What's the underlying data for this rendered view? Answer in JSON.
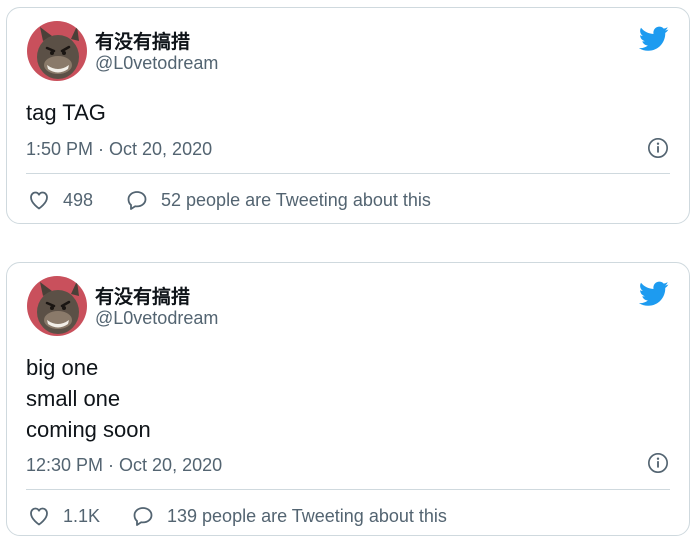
{
  "colors": {
    "twitter_blue": "#1d9bf0",
    "secondary_text": "#536471",
    "border": "#cfd9de",
    "avatar_bg": "#c9505c"
  },
  "tweets": [
    {
      "display_name": "有没有搞措",
      "handle": "@L0vetodream",
      "text": [
        "tag TAG"
      ],
      "timestamp": "1:50 PM · Oct 20, 2020",
      "likes": "498",
      "replies_text": "52 people are Tweeting about this"
    },
    {
      "display_name": "有没有搞措",
      "handle": "@L0vetodream",
      "text": [
        "big one",
        "small one",
        "coming soon"
      ],
      "timestamp": "12:30 PM · Oct 20, 2020",
      "likes": "1.1K",
      "replies_text": "139 people are Tweeting about this"
    }
  ],
  "icons": {
    "brand": "twitter-bird-icon",
    "info": "info-icon",
    "like": "heart-icon",
    "reply": "speech-bubble-icon"
  }
}
